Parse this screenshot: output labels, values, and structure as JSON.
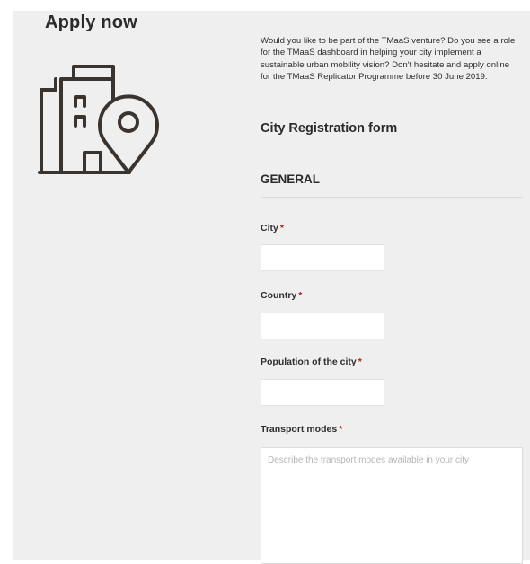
{
  "page": {
    "title": "Apply now",
    "icon": "building-location-pin-icon"
  },
  "form": {
    "intro": "Would you like to be part of the TMaaS venture? Do you see a role for the TMaaS dashboard in helping your city implement a sustainable urban mobility vision? Don't hesitate and apply online for the TMaaS Replicator Programme before 30 June 2019.",
    "title": "City Registration form",
    "section_title": "GENERAL",
    "required_marker": "*",
    "fields": [
      {
        "label": "City",
        "value": "",
        "required": true
      },
      {
        "label": "Country",
        "value": "",
        "required": true
      },
      {
        "label": "Population of the city",
        "value": "",
        "required": true
      }
    ],
    "transport": {
      "label": "Transport modes",
      "value": "",
      "placeholder": "Describe the transport modes available in your city",
      "required": true
    }
  },
  "colors": {
    "background": "#efefef",
    "required": "#b01f24",
    "icon_stroke": "#3a3431"
  }
}
